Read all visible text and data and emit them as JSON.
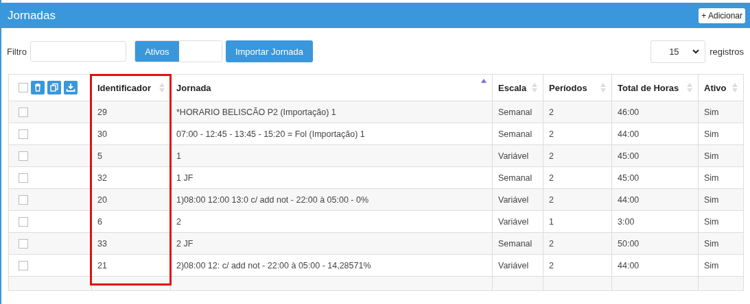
{
  "window": {
    "title": "Jornadas"
  },
  "add_button": {
    "label": "+ Adicionar"
  },
  "filter": {
    "label": "Filtro"
  },
  "active_toggle": {
    "label": "Ativos",
    "on": true
  },
  "import_button": {
    "label": "Importar Jornada"
  },
  "page_size": {
    "value": "15",
    "label": "registros"
  },
  "table": {
    "columns": [
      {
        "label": "Identificador",
        "sorted": false
      },
      {
        "label": "Jornada",
        "sorted": true
      },
      {
        "label": "Escala",
        "sorted": false
      },
      {
        "label": "Períodos",
        "sorted": false
      },
      {
        "label": "Total de Horas",
        "sorted": false
      },
      {
        "label": "Ativo",
        "sorted": false
      }
    ],
    "select_all": {
      "checked": false
    },
    "rows": [
      {
        "checked": false,
        "cells": [
          "29",
          "*HORARIO BELISCÃO P2 (Importação) 1",
          "Semanal",
          "2",
          "46:00",
          "Sim"
        ]
      },
      {
        "checked": false,
        "cells": [
          "30",
          "07:00 - 12:45 - 13:45 - 15:20 = Fol (Importação) 1",
          "Semanal",
          "2",
          "44:00",
          "Sim"
        ]
      },
      {
        "checked": false,
        "cells": [
          "5",
          "1",
          "Variável",
          "2",
          "45:00",
          "Sim"
        ]
      },
      {
        "checked": false,
        "cells": [
          "32",
          "1 JF",
          "Semanal",
          "2",
          "45:00",
          "Sim"
        ]
      },
      {
        "checked": false,
        "cells": [
          "20",
          "1)08:00 12:00 13:0 c/ add not - 22:00 à 05:00 - 0%",
          "Variável",
          "2",
          "44:00",
          "Sim"
        ]
      },
      {
        "checked": false,
        "cells": [
          "6",
          "2",
          "Variável",
          "1",
          "3:00",
          "Sim"
        ]
      },
      {
        "checked": false,
        "cells": [
          "33",
          "2 JF",
          "Semanal",
          "2",
          "50:00",
          "Sim"
        ]
      },
      {
        "checked": false,
        "cells": [
          "21",
          "2)08:00 12: c/ add not - 22:00 à 05:00 - 14,28571%",
          "Variável",
          "2",
          "44:00",
          "Sim"
        ]
      }
    ]
  }
}
